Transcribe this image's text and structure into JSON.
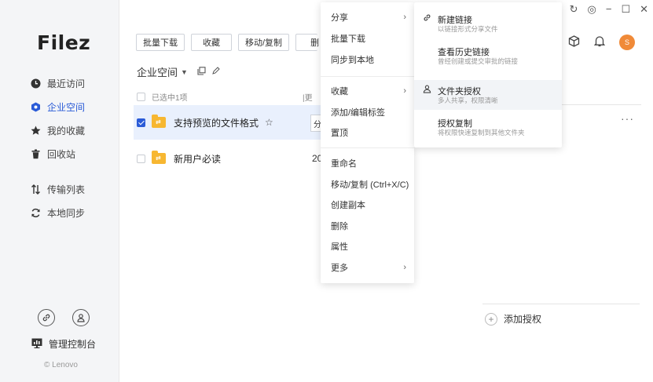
{
  "app": {
    "logo": "Filez",
    "copyright": "© Lenovo"
  },
  "sidebar": {
    "items": [
      {
        "label": "最近访问",
        "icon": "clock-icon"
      },
      {
        "label": "企业空间",
        "icon": "enterprise-icon"
      },
      {
        "label": "我的收藏",
        "icon": "star-icon"
      },
      {
        "label": "回收站",
        "icon": "trash-icon"
      },
      {
        "label": "传输列表",
        "icon": "transfer-icon"
      },
      {
        "label": "本地同步",
        "icon": "sync-icon"
      }
    ],
    "admin_label": "管理控制台"
  },
  "toolbar": {
    "batch_download": "批量下载",
    "favorite": "收藏",
    "move_copy": "移动/复制",
    "partial": "删"
  },
  "breadcrumb": {
    "label": "企业空间"
  },
  "list": {
    "selected_count": "已选中1项",
    "col_partial": "更",
    "rows": [
      {
        "name": "支持预览的文件格式",
        "selected": true,
        "col_partial": "分"
      },
      {
        "name": "新用户必读",
        "selected": false,
        "date_partial": "20"
      }
    ]
  },
  "context_menu": {
    "items": [
      {
        "label": "分享",
        "submenu": true
      },
      {
        "label": "批量下载"
      },
      {
        "label": "同步到本地"
      },
      {
        "label": "收藏",
        "submenu": true
      },
      {
        "label": "添加/编辑标签"
      },
      {
        "label": "置顶"
      },
      {
        "label": "重命名"
      },
      {
        "label": "移动/复制 (Ctrl+X/C)"
      },
      {
        "label": "创建副本"
      },
      {
        "label": "删除"
      },
      {
        "label": "属性"
      },
      {
        "label": "更多",
        "submenu": true
      }
    ]
  },
  "share_submenu": {
    "items": [
      {
        "title": "新建链接",
        "desc": "以链接形式分享文件",
        "icon": "link-icon"
      },
      {
        "title": "查看历史链接",
        "desc": "曾经创建或提交审批的链接",
        "icon": ""
      },
      {
        "title": "文件夹授权",
        "desc": "多人共享，权限清晰",
        "icon": "user-icon"
      },
      {
        "title": "授权复制",
        "desc": "将权限快速复制到其他文件夹",
        "icon": ""
      }
    ]
  },
  "right_panel": {
    "add_auth_label": "添加授权",
    "avatar_letter": "S"
  },
  "colors": {
    "accent": "#2a5bd7",
    "folder": "#f7b731",
    "avatar": "#f08a38"
  }
}
